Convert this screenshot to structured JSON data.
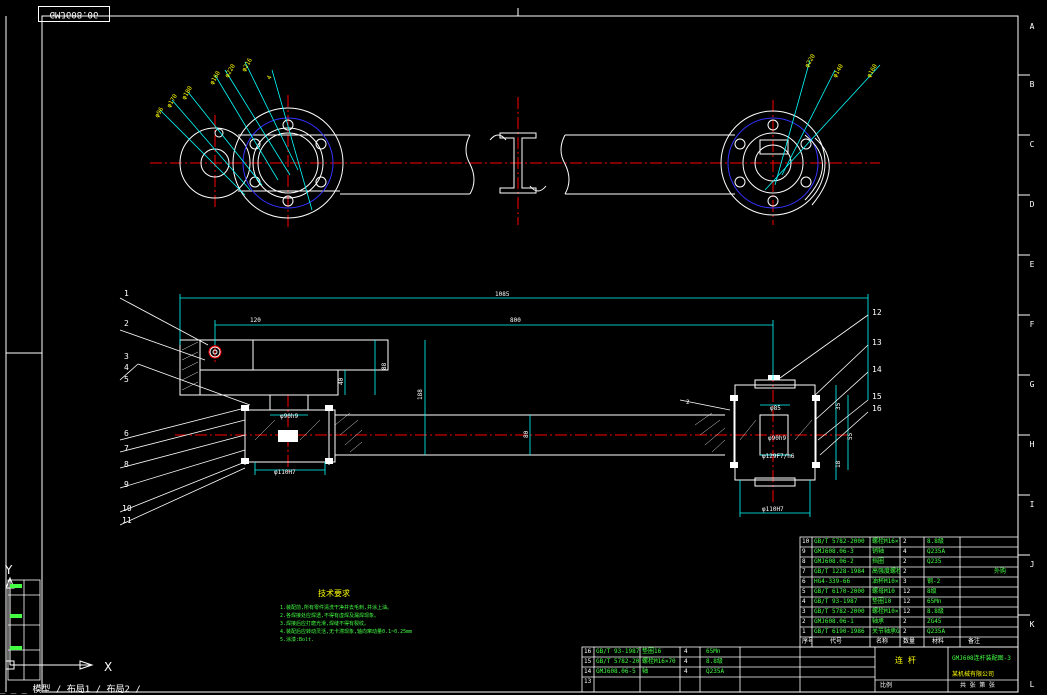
{
  "drawing": {
    "stamp": "GMJ608.06",
    "zones": [
      "A",
      "B",
      "C",
      "D",
      "E",
      "F",
      "G",
      "H",
      "I",
      "J",
      "K",
      "L"
    ],
    "callouts": [
      "1",
      "2",
      "3",
      "4",
      "5",
      "6",
      "7",
      "8",
      "9",
      "10",
      "11",
      "12",
      "13",
      "14",
      "15",
      "16"
    ],
    "dimensions": {
      "overall": "1085",
      "left_offset": "120",
      "span": "800",
      "h1": "88",
      "h2": "188",
      "h3": "40",
      "shaft": "80",
      "bore_left": "φ110H7",
      "bore_right": "φ110H7",
      "bore_right_inner": "φ129F7/h6",
      "left_mid": "φ90h9",
      "right_d1": "φ85",
      "right_d2": "φ90h9",
      "side1": "35",
      "side2": "55",
      "side3": "18",
      "small": "2"
    },
    "notes": {
      "title": "技术要求",
      "items": [
        "1.装配前,所有零件清洗干净并去毛刺,并涂上油。",
        "2.各焊接处应焊透,不得有虚焊及漏焊现象。",
        "3.焊接后应打磨光滑,焊缝不得有裂纹。",
        "4.装配后应转动灵活,无卡滞现象,轴向窜动量0.1~0.25mm",
        "5.涂漆:Bolt."
      ]
    },
    "ucs": {
      "y": "Y",
      "x": "X"
    },
    "command_line": "_ _ _ 模型 / 布局1 / 布局2 /"
  },
  "bom_upper": [
    {
      "no": "10",
      "code": "GB/T 5782-2000",
      "name": "螺栓M16×70",
      "qty": "2",
      "mat": "8.8级",
      "note": ""
    },
    {
      "no": "9",
      "code": "GMJ608.06-3",
      "name": "销轴",
      "qty": "4",
      "mat": "Q235A",
      "note": ""
    },
    {
      "no": "8",
      "code": "GMJ608.06-2",
      "name": "挡圈",
      "qty": "2",
      "mat": "Q235",
      "note": ""
    },
    {
      "no": "7",
      "code": "GB/T 1228-1984",
      "name": "高强度螺栓M24",
      "qty": "2",
      "mat": "",
      "note": "外购"
    },
    {
      "no": "6",
      "code": "HG4-339-66",
      "name": "油杯M10×1",
      "qty": "3",
      "mat": "钢-2",
      "note": ""
    },
    {
      "no": "5",
      "code": "GB/T 6170-2000",
      "name": "螺母M10",
      "qty": "12",
      "mat": "8级",
      "note": ""
    },
    {
      "no": "4",
      "code": "GB/T 93-1987",
      "name": "垫圈10",
      "qty": "12",
      "mat": "65Mn",
      "note": ""
    },
    {
      "no": "3",
      "code": "GB/T 5782-2000",
      "name": "螺栓M10×75",
      "qty": "12",
      "mat": "8.8级",
      "note": ""
    },
    {
      "no": "2",
      "code": "GMJ608.06-1",
      "name": "轴承",
      "qty": "2",
      "mat": "ZG45",
      "note": ""
    },
    {
      "no": "1",
      "code": "GB/T 6190-1986",
      "name": "关节轴承GE80",
      "qty": "2",
      "mat": "Q235A",
      "note": ""
    }
  ],
  "bom_upper_header": {
    "no": "序号",
    "code": "代号",
    "name": "名称",
    "qty": "数量",
    "mat": "材料",
    "note": "备注"
  },
  "bom_lower": [
    {
      "no": "16",
      "code": "GB/T 93-1987",
      "name": "垫圈16",
      "qty": "4",
      "mat": "65Mn"
    },
    {
      "no": "15",
      "code": "GB/T 5782-2000",
      "name": "螺栓M16×70",
      "qty": "4",
      "mat": "8.8级"
    },
    {
      "no": "14",
      "code": "GMJ608.06-5",
      "name": "轴",
      "qty": "4",
      "mat": "Q235A"
    },
    {
      "no": "13",
      "code": "",
      "name": "",
      "qty": "",
      "mat": ""
    }
  ],
  "title_block": {
    "part_label": "连 杆",
    "drawing_no": "GMJ608连杆装配图-3",
    "company": "某机械有限公司",
    "scale_label": "比例",
    "sheet": "共 张 第 张"
  },
  "colors": {
    "cyan": "#00ffff",
    "red": "#ff0000",
    "white": "#ffffff",
    "yellow": "#ffff00",
    "green": "#44ff44",
    "blue": "#3333ff"
  }
}
